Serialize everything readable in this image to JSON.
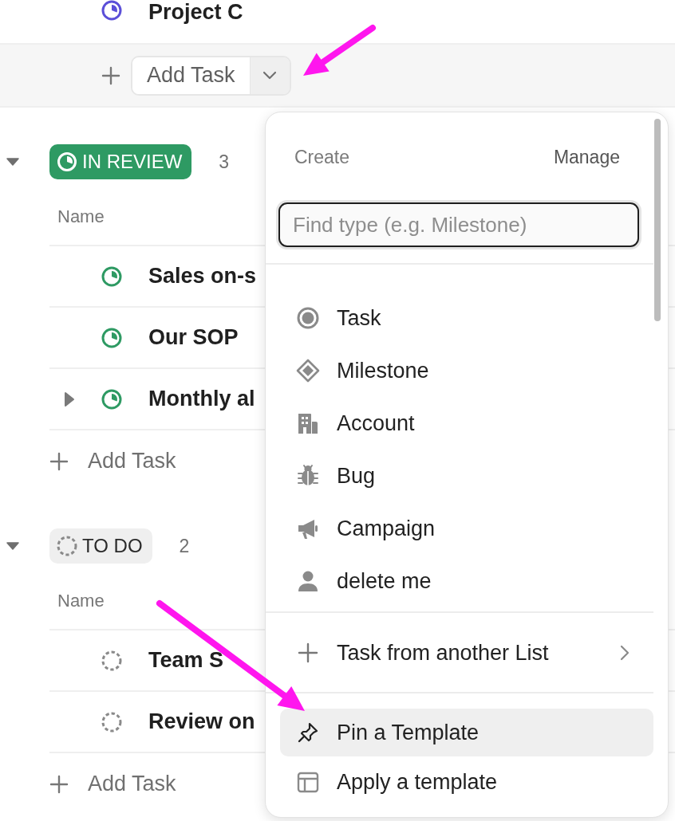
{
  "groups": [
    {
      "color": "#5b4fd8",
      "kind": "progress",
      "tasks": [
        {
          "name": "Project C",
          "has_subtasks": false
        }
      ],
      "add_task": {
        "label": "Add Task",
        "split": true
      }
    },
    {
      "label": "IN REVIEW",
      "count": "3",
      "expanded": true,
      "color": "#2e9a63",
      "kind": "progress",
      "column": "Name",
      "tasks": [
        {
          "name": "Sales on-s",
          "has_subtasks": false
        },
        {
          "name": "Our SOP",
          "has_subtasks": false
        },
        {
          "name": "Monthly al",
          "has_subtasks": true
        }
      ],
      "add_task": {
        "label": "Add Task",
        "split": false
      }
    },
    {
      "label": "TO DO",
      "count": "2",
      "expanded": true,
      "color": "#8a8a8a",
      "kind": "dashed",
      "column": "Name",
      "tasks": [
        {
          "name": "Team S",
          "has_subtasks": false
        },
        {
          "name": "Review on",
          "has_subtasks": false
        }
      ],
      "add_task": {
        "label": "Add Task",
        "split": false
      }
    }
  ],
  "menu": {
    "title": "Create",
    "action": "Manage",
    "search": {
      "placeholder": "Find type (e.g. Milestone)",
      "focused": true
    },
    "types": [
      {
        "label": "Task",
        "kind": "task",
        "selected": false
      },
      {
        "label": "Milestone",
        "kind": "milestone",
        "selected": false
      },
      {
        "label": "Account",
        "kind": "building",
        "selected": false
      },
      {
        "label": "Bug",
        "kind": "bug",
        "selected": false
      },
      {
        "label": "Campaign",
        "kind": "megaphone",
        "selected": false
      },
      {
        "label": "delete me",
        "kind": "person",
        "selected": false
      }
    ],
    "list_actions": [
      {
        "label": "Task from another List",
        "kind": "plus",
        "submenu": true,
        "selected": false
      }
    ],
    "template_actions": [
      {
        "label": "Pin a Template",
        "kind": "pin",
        "submenu": false,
        "selected": true
      },
      {
        "label": "Apply a template",
        "kind": "template",
        "submenu": false,
        "selected": false
      }
    ]
  }
}
